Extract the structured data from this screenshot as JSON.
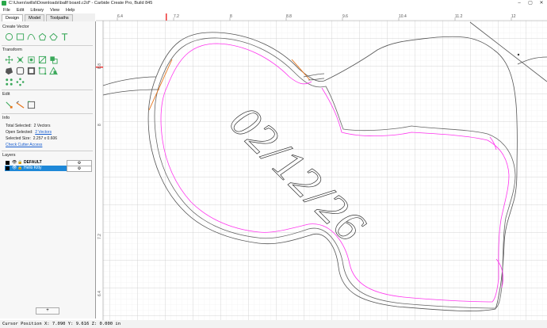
{
  "window": {
    "title": "C:\\Users\\willsl\\Downloads\\ballf board.c2d* - Carbide Create Pro, Build 845",
    "minimize": "–",
    "maximize": "▢",
    "close": "✕"
  },
  "menu": [
    "File",
    "Edit",
    "Library",
    "View",
    "Help"
  ],
  "tabs": [
    "Design",
    "Model",
    "Toolpaths"
  ],
  "sections": {
    "create_vector": "Create Vector",
    "transform": "Transform",
    "edit": "Edit",
    "info": "Info",
    "layers": "Layers"
  },
  "icons": {
    "create": [
      "circle-icon",
      "rectangle-icon",
      "curve-icon",
      "polygon-icon",
      "pentagon-icon",
      "text-icon"
    ],
    "transform_row1": [
      "move-icon",
      "scale-icon",
      "rotate-icon",
      "mirror-icon",
      "align-icon"
    ],
    "transform_row2": [
      "offset-icon",
      "boolean-icon",
      "group-icon",
      "join-icon",
      "triangle-icon"
    ],
    "transform_row3": [
      "array-icon",
      "circular-array-icon"
    ],
    "edit": [
      "node-edit-icon",
      "knife-icon",
      "trim-icon"
    ]
  },
  "info": {
    "total_selected_label": "Total Selected:",
    "total_selected_value": "2 Vectors",
    "open_selected_label": "Open Selected:",
    "open_selected_value": "2 Vectors",
    "selected_size_label": "Selected Size:",
    "selected_size_value": "2.257 x 0.606",
    "check_cutter": "Check Cutter Access"
  },
  "layers": [
    {
      "name": "DEFAULT",
      "color": "#000000",
      "selected": false
    },
    {
      "name": "Hello Kitty",
      "color": "#000000",
      "selected": true
    }
  ],
  "add_layer": "+",
  "ruler": {
    "top": [
      "6.4",
      "7.2",
      "8",
      "8.8",
      "9.6",
      "10.4",
      "11.2",
      "12"
    ],
    "left": [
      "8.8",
      "8",
      "7.2",
      "6.4"
    ]
  },
  "engraving_text": "02/12/26",
  "status": "Cursor Position X: 7.090 Y: 9.616 Z: 0.000 in",
  "colors": {
    "accent": "#1e88d8",
    "green_icons": "#3aa85a",
    "pink_path": "#ff33ee",
    "orange_path": "#e6741a"
  }
}
